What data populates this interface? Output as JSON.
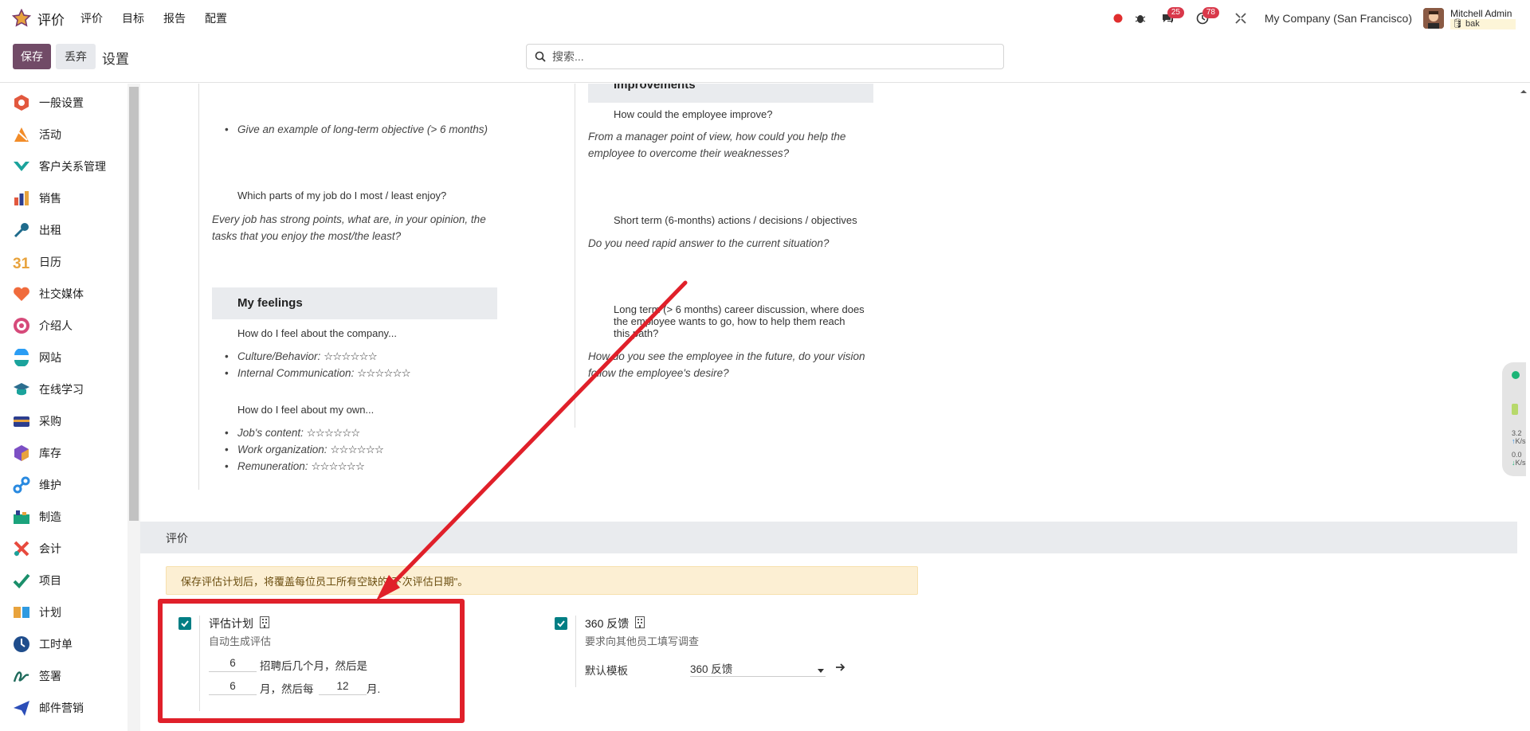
{
  "navbar": {
    "app_name": "评价",
    "menu": [
      "评价",
      "目标",
      "报告",
      "配置"
    ],
    "chat_badge": "25",
    "activity_badge": "78",
    "company": "My Company (San Francisco)",
    "user_name": "Mitchell Admin",
    "user_db": "bak"
  },
  "control": {
    "save": "保存",
    "discard": "丢弃",
    "title": "设置",
    "search_placeholder": "搜索..."
  },
  "sidebar": {
    "items": [
      {
        "label": "一般设置",
        "icon": "general-settings-icon",
        "color": "#e2583e"
      },
      {
        "label": "活动",
        "icon": "activities-icon",
        "color": "#f28c28"
      },
      {
        "label": "客户关系管理",
        "icon": "crm-icon",
        "color": "#1ba39c"
      },
      {
        "label": "销售",
        "icon": "sales-icon",
        "color": "#e2583e"
      },
      {
        "label": "出租",
        "icon": "rental-icon",
        "color": "#1f6b8c"
      },
      {
        "label": "日历",
        "icon": "calendar-icon",
        "color": "#e8a33d"
      },
      {
        "label": "社交媒体",
        "icon": "social-media-icon",
        "color": "#f06b3c"
      },
      {
        "label": "介绍人",
        "icon": "referral-icon",
        "color": "#d64a7a"
      },
      {
        "label": "网站",
        "icon": "website-icon",
        "color": "#2a9df4"
      },
      {
        "label": "在线学习",
        "icon": "elearning-icon",
        "color": "#2c6e8f"
      },
      {
        "label": "采购",
        "icon": "purchase-icon",
        "color": "#2c3e8f"
      },
      {
        "label": "库存",
        "icon": "inventory-icon",
        "color": "#7c4fc4"
      },
      {
        "label": "维护",
        "icon": "maintenance-icon",
        "color": "#2a8ae0"
      },
      {
        "label": "制造",
        "icon": "manufacturing-icon",
        "color": "#1ba37c"
      },
      {
        "label": "会计",
        "icon": "accounting-icon",
        "color": "#e84a3e"
      },
      {
        "label": "项目",
        "icon": "project-icon",
        "color": "#1b8f6b"
      },
      {
        "label": "计划",
        "icon": "planning-icon",
        "color": "#2f9ae0"
      },
      {
        "label": "工时单",
        "icon": "timesheet-icon",
        "color": "#1f4d8c"
      },
      {
        "label": "签署",
        "icon": "sign-icon",
        "color": "#1f6b5c"
      },
      {
        "label": "邮件营销",
        "icon": "email-marketing-icon",
        "color": "#2c4eb8"
      }
    ]
  },
  "template": {
    "left": {
      "q1_item": "Give an example of long-term objective (> 6 months)",
      "q2": "Which parts of my job do I most / least enjoy?",
      "q2_hint_1": "Every job has strong points, what are, in your opinion, the",
      "q2_hint_2": "tasks that you enjoy the most/the least?",
      "feelings_header": "My feelings",
      "q3": "How do I feel about the company...",
      "q3_items": [
        "Culture/Behavior:",
        "Internal Communication:"
      ],
      "q4": "How do I feel about my own...",
      "q4_items": [
        "Job's content:",
        "Work organization:",
        "Remuneration:"
      ],
      "stars": "☆☆☆☆☆☆"
    },
    "right": {
      "improvements_header": "Improvements",
      "r1": "How could the employee improve?",
      "r1_hint_1": "From a manager point of view, how could you help the",
      "r1_hint_2": "employee to overcome their weaknesses?",
      "r2": "Short term (6-months) actions / decisions / objectives",
      "r2_hint": "Do you need rapid answer to the current situation?",
      "r3_1": "Long term (> 6 months) career discussion, where does",
      "r3_2": "the employee wants to go, how to help them reach",
      "r3_3": "this path?",
      "r3_hint_1": "How do you see the employee in the future, do your vision",
      "r3_hint_2": "follow the employee's desire?"
    }
  },
  "appraisal": {
    "section_title": "评价",
    "alert": "保存评估计划后，将覆盖每位员工所有空缺的\"下次评估日期\"。",
    "plan_title": "评估计划",
    "plan_desc": "自动生成评估",
    "months_after_hire": "6",
    "after_hire_label": "招聘后几个月，然后是",
    "then_months": "6",
    "then_label": "月，然后每",
    "every_months": "12",
    "month_suffix": "月.",
    "feedback_title": "360 反馈",
    "feedback_desc": "要求向其他员工填写调查",
    "default_template_label": "默认模板",
    "default_template_value": "360 反馈"
  },
  "widget": {
    "up": "3.2",
    "up_unit": "K/s",
    "down": "0.0",
    "down_unit": "K/s"
  }
}
